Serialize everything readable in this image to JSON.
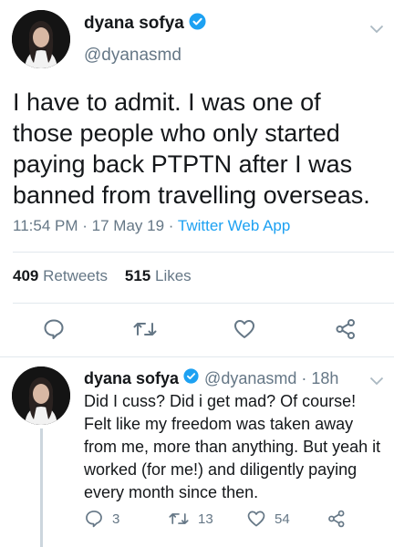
{
  "main_tweet": {
    "author_name": "dyana sofya",
    "author_handle": "@dyanasmd",
    "verified": true,
    "text": "I have to admit. I was one of those people who only started paying back PTPTN after I was banned from travelling overseas.",
    "time": "11:54 PM",
    "date": "17 May 19",
    "separator": "·",
    "source": "Twitter Web App",
    "retweets_count": "409",
    "retweets_label": "Retweets",
    "likes_count": "515",
    "likes_label": "Likes",
    "icons": [
      "reply-icon",
      "retweet-icon",
      "like-icon",
      "share-icon"
    ]
  },
  "reply_tweet": {
    "author_name": "dyana sofya",
    "author_handle": "@dyanasmd · 18h",
    "verified": true,
    "text": "Did I cuss? Did i get mad? Of course! Felt like my freedom was taken away from me, more than anything. But yeah it worked (for me!) and diligently paying every month since then.",
    "reply_count": "3",
    "retweet_count": "13",
    "like_count": "54"
  },
  "colors": {
    "accent": "#1da1f2",
    "secondary_text": "#657786",
    "primary_text": "#14171a",
    "divider": "#e1e8ed"
  }
}
